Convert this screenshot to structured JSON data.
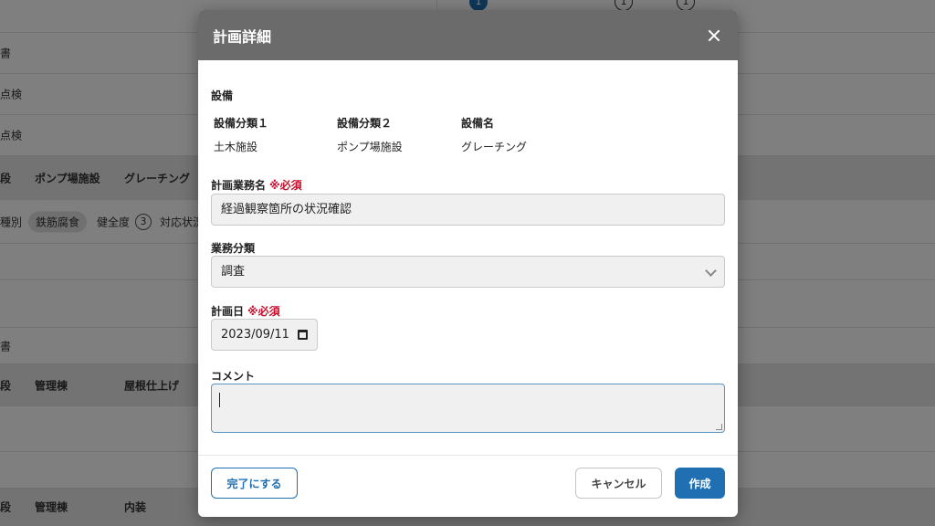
{
  "background": {
    "rows": [
      {
        "c1": "書"
      },
      {
        "c1": "点検"
      },
      {
        "c1": "点検"
      },
      {
        "c1": "段",
        "c2": "ポンプ場施設",
        "c3": "グレーチング"
      },
      {
        "c1": "種別",
        "chip": "鉄筋腐食",
        "health_label": "健全度",
        "health_value": "3",
        "status": "対応状況"
      },
      {
        "c1": "書"
      },
      {
        "c1": "段",
        "c2": "管理棟",
        "c3": "屋根仕上げ"
      },
      {
        "c1": "段",
        "c2": "管理棟",
        "c3": "内装"
      }
    ],
    "steps": [
      "1",
      "1",
      "1"
    ],
    "more": "•••"
  },
  "modal": {
    "title": "計画詳細",
    "equipment_section": "設備",
    "equipment": [
      {
        "header": "設備分類１",
        "value": "土木施設"
      },
      {
        "header": "設備分類２",
        "value": "ポンプ場施設"
      },
      {
        "header": "設備名",
        "value": "グレーチング"
      }
    ],
    "plan_name_label": "計画業務名",
    "required": "※必須",
    "plan_name_value": "経過観察箇所の状況確認",
    "category_label": "業務分類",
    "category_value": "調査",
    "date_label": "計画日",
    "date_value": "2023/09/11",
    "comment_label": "コメント",
    "comment_value": "",
    "buttons": {
      "complete": "完了にする",
      "cancel": "キャンセル",
      "create": "作成"
    }
  },
  "colors": {
    "accent": "#1f6fb2",
    "required": "#c8102e",
    "header_bg": "#6b6b6b"
  }
}
